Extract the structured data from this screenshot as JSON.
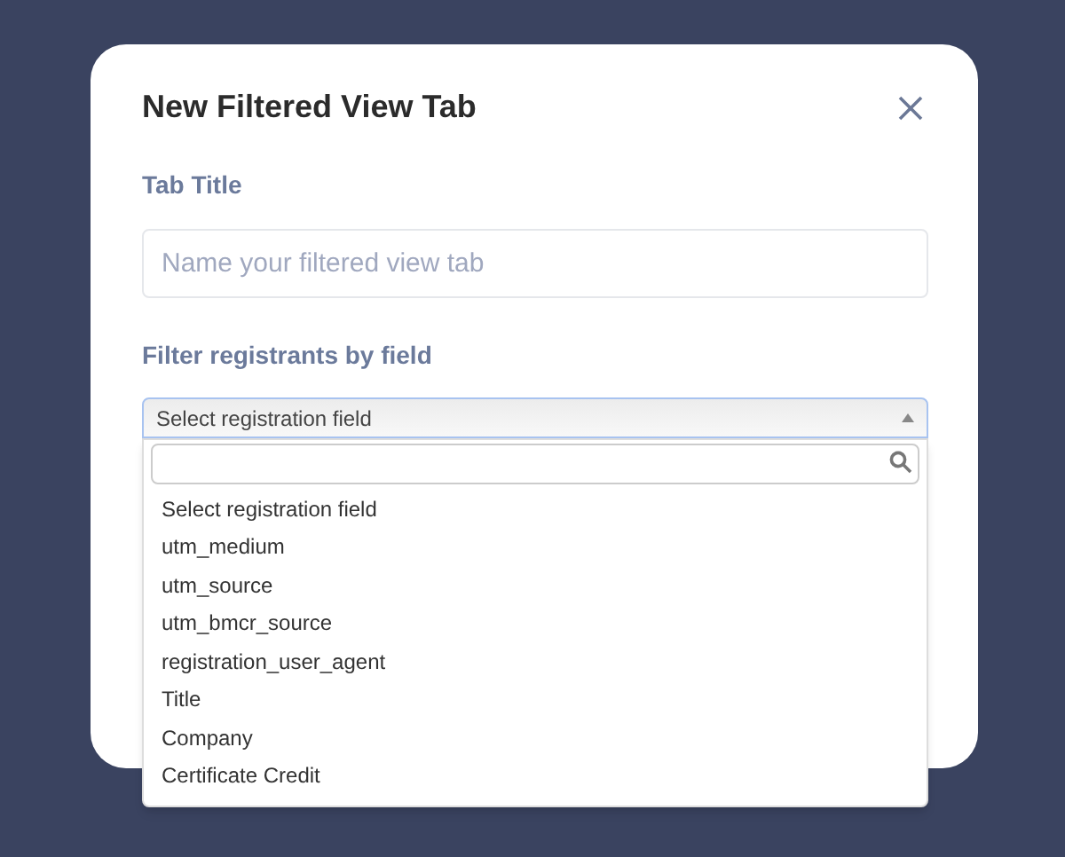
{
  "dialog": {
    "title": "New Filtered View Tab"
  },
  "tab_title": {
    "label": "Tab Title",
    "placeholder": "Name your filtered view tab"
  },
  "filter": {
    "label": "Filter registrants by field",
    "select_value": "Select registration field",
    "expanded": true,
    "options": [
      {
        "label": "Select registration field"
      },
      {
        "label": "utm_medium"
      },
      {
        "label": "utm_source"
      },
      {
        "label": "utm_bmcr_source"
      },
      {
        "label": "registration_user_agent"
      },
      {
        "label": "Title"
      },
      {
        "label": "Company"
      },
      {
        "label": "Certificate Credit"
      }
    ]
  }
}
